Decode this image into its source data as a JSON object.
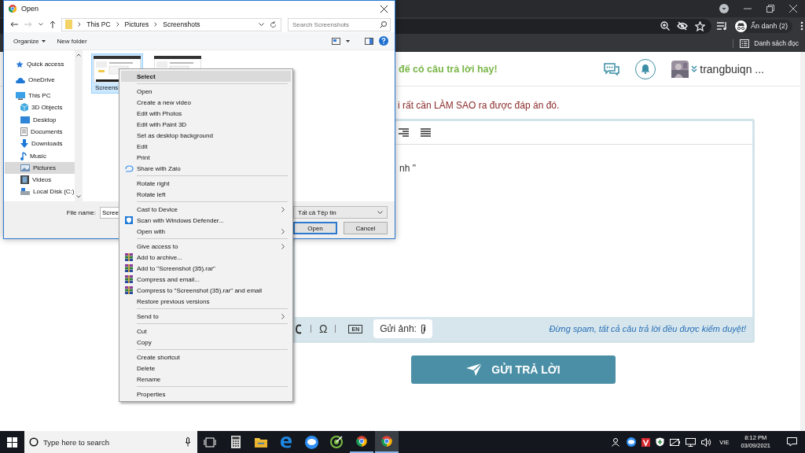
{
  "browser": {
    "profile_label": "Ẩn danh (2)",
    "reading_list": "Danh sách đọc"
  },
  "page": {
    "banner": "đế có câu trả lời hay!",
    "user_name": "trangbuiqn ...",
    "notice": "i rất cần LÀM SAO ra được đáp án đó.",
    "editor": {
      "content": "nh \"",
      "special_char": "Ω",
      "language": "EN",
      "image_label": "Gửi ảnh:",
      "hint": "Đừng spam, tất cả câu trả lời đều được kiểm duyệt!"
    },
    "submit": "GỬI TRẢ LỜI"
  },
  "dialog": {
    "title": "Open",
    "breadcrumb": [
      "This PC",
      "Pictures",
      "Screenshots"
    ],
    "search": {
      "placeholder": "Search Screenshots"
    },
    "commands": [
      "Organize",
      "New folder"
    ],
    "nav": [
      {
        "label": "Quick access",
        "kind": "star",
        "selected": false
      },
      {
        "label": "OneDrive",
        "kind": "cloud",
        "selected": false
      },
      {
        "label": "This PC",
        "kind": "pc",
        "selected": false,
        "children": [
          {
            "label": "3D Objects",
            "kind": "cube",
            "selected": false
          },
          {
            "label": "Desktop",
            "kind": "desktop",
            "selected": false
          },
          {
            "label": "Documents",
            "kind": "documents",
            "selected": false
          },
          {
            "label": "Downloads",
            "kind": "download",
            "selected": false
          },
          {
            "label": "Music",
            "kind": "music",
            "selected": false
          },
          {
            "label": "Pictures",
            "kind": "pictures",
            "selected": true
          },
          {
            "label": "Videos",
            "kind": "videos",
            "selected": false
          },
          {
            "label": "Local Disk (C:)",
            "kind": "disk",
            "selected": false
          }
        ]
      }
    ],
    "files": [
      {
        "label": "Screens",
        "selected": true
      },
      {
        "selected": false
      }
    ],
    "file_name": {
      "label": "File name:",
      "value": "Scree"
    },
    "file_type": "Tất cả Tệp tin",
    "buttons": [
      {
        "label": "Open",
        "default": true
      },
      {
        "label": "Cancel",
        "default": false
      }
    ]
  },
  "context_menu": {
    "groups": [
      [
        {
          "label": "Select",
          "kind": "plain",
          "submenu": false,
          "default": true,
          "selected": true
        }
      ],
      [
        {
          "label": "Open",
          "kind": "plain",
          "submenu": false,
          "default": false,
          "selected": false
        },
        {
          "label": "Create a new video",
          "kind": "plain",
          "submenu": false,
          "default": false,
          "selected": false
        },
        {
          "label": "Edit with Photos",
          "kind": "plain",
          "submenu": false,
          "default": false,
          "selected": false
        },
        {
          "label": "Edit with Paint 3D",
          "kind": "plain",
          "submenu": false,
          "default": false,
          "selected": false
        },
        {
          "label": "Set as desktop background",
          "kind": "plain",
          "submenu": false,
          "default": false,
          "selected": false
        },
        {
          "label": "Edit",
          "kind": "plain",
          "submenu": false,
          "default": false,
          "selected": false
        },
        {
          "label": "Print",
          "kind": "plain",
          "submenu": false,
          "default": false,
          "selected": false
        },
        {
          "label": "Share with Zalo",
          "kind": "zalo",
          "submenu": false,
          "default": false,
          "selected": false
        }
      ],
      [
        {
          "label": "Rotate right",
          "kind": "plain",
          "submenu": false,
          "default": false,
          "selected": false
        },
        {
          "label": "Rotate left",
          "kind": "plain",
          "submenu": false,
          "default": false,
          "selected": false
        }
      ],
      [
        {
          "label": "Cast to Device",
          "kind": "plain",
          "submenu": true,
          "default": false,
          "selected": false
        },
        {
          "label": "Scan with Windows Defender...",
          "kind": "defender",
          "submenu": false,
          "default": false,
          "selected": false
        },
        {
          "label": "Open with",
          "kind": "plain",
          "submenu": true,
          "default": false,
          "selected": false
        }
      ],
      [
        {
          "label": "Give access to",
          "kind": "plain",
          "submenu": true,
          "default": false,
          "selected": false
        },
        {
          "label": "Add to archive...",
          "kind": "archive",
          "submenu": false,
          "default": false,
          "selected": false
        },
        {
          "label": "Add to \"Screenshot (35).rar\"",
          "kind": "archive",
          "submenu": false,
          "default": false,
          "selected": false
        },
        {
          "label": "Compress and email...",
          "kind": "archive",
          "submenu": false,
          "default": false,
          "selected": false
        },
        {
          "label": "Compress to \"Screenshot (35).rar\" and email",
          "kind": "archive",
          "submenu": false,
          "default": false,
          "selected": false
        },
        {
          "label": "Restore previous versions",
          "kind": "plain",
          "submenu": false,
          "default": false,
          "selected": false
        }
      ],
      [
        {
          "label": "Send to",
          "kind": "plain",
          "submenu": true,
          "default": false,
          "selected": false
        }
      ],
      [
        {
          "label": "Cut",
          "kind": "plain",
          "submenu": false,
          "default": false,
          "selected": false
        },
        {
          "label": "Copy",
          "kind": "plain",
          "submenu": false,
          "default": false,
          "selected": false
        }
      ],
      [
        {
          "label": "Create shortcut",
          "kind": "plain",
          "submenu": false,
          "default": false,
          "selected": false
        },
        {
          "label": "Delete",
          "kind": "plain",
          "submenu": false,
          "default": false,
          "selected": false
        },
        {
          "label": "Rename",
          "kind": "plain",
          "submenu": false,
          "default": false,
          "selected": false
        }
      ],
      [
        {
          "label": "Properties",
          "kind": "plain",
          "submenu": false,
          "default": false,
          "selected": false
        }
      ]
    ]
  },
  "taskbar": {
    "search": {
      "placeholder": "Type here to search"
    },
    "apps": [
      {
        "kind": "calculator",
        "running": false,
        "selected": false
      },
      {
        "kind": "folder",
        "running": false,
        "selected": false
      },
      {
        "kind": "edge",
        "running": false,
        "selected": false
      },
      {
        "kind": "zalo",
        "running": false,
        "selected": false
      },
      {
        "kind": "target",
        "running": false,
        "selected": false
      },
      {
        "kind": "chrome",
        "running": true,
        "selected": false
      },
      {
        "kind": "chrome",
        "running": true,
        "selected": true
      }
    ],
    "language": "VIE",
    "time": "8:12 PM",
    "date": "03/09/2021"
  }
}
